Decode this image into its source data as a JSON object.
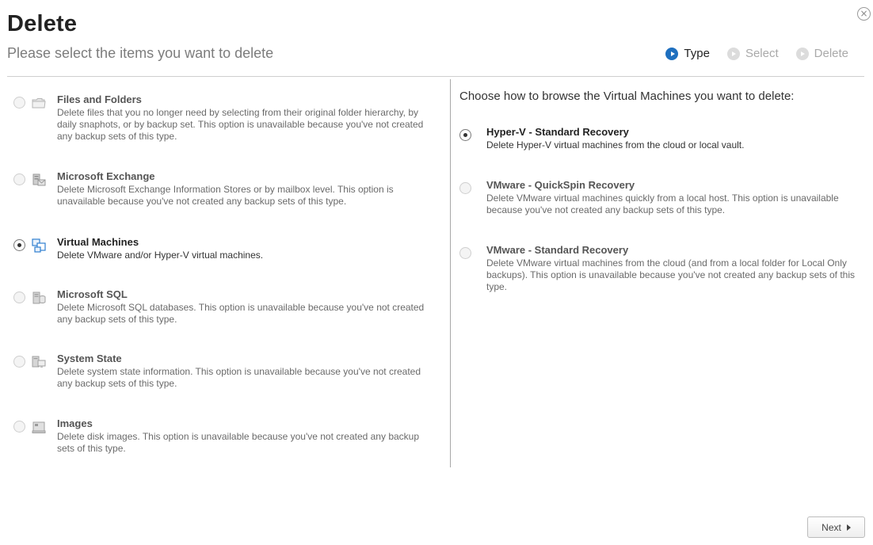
{
  "window": {
    "title": "Delete",
    "subtitle": "Please select the items you want to delete",
    "close_glyph": "×"
  },
  "steps": [
    {
      "label": "Type",
      "state": "active"
    },
    {
      "label": "Select",
      "state": "pending"
    },
    {
      "label": "Delete",
      "state": "pending"
    }
  ],
  "left_options": [
    {
      "title": "Files and Folders",
      "desc": "Delete files that you no longer need by selecting from their original folder hierarchy, by daily snaphots, or by backup set. This option is unavailable because you've not created any backup sets of this type.",
      "icon": "folder-icon",
      "selected": false,
      "enabled": false
    },
    {
      "title": "Microsoft Exchange",
      "desc": "Delete Microsoft Exchange Information Stores or by mailbox level. This option is unavailable because you've not created any backup sets of this type.",
      "icon": "exchange-server-icon",
      "selected": false,
      "enabled": false
    },
    {
      "title": "Virtual Machines",
      "desc": "Delete VMware and/or Hyper-V virtual machines.",
      "icon": "virtual-machines-icon",
      "selected": true,
      "enabled": true
    },
    {
      "title": "Microsoft SQL",
      "desc": "Delete Microsoft SQL databases. This option is unavailable because you've not created any backup sets of this type.",
      "icon": "sql-server-icon",
      "selected": false,
      "enabled": false
    },
    {
      "title": "System State",
      "desc": "Delete system state information. This option is unavailable because you've not created any backup sets of this type.",
      "icon": "system-state-icon",
      "selected": false,
      "enabled": false
    },
    {
      "title": "Images",
      "desc": "Delete disk images. This option is unavailable because you've not created any backup sets of this type.",
      "icon": "disk-image-icon",
      "selected": false,
      "enabled": false
    }
  ],
  "right_panel": {
    "heading": "Choose how to browse the Virtual Machines you want to delete:",
    "options": [
      {
        "title": "Hyper-V - Standard Recovery",
        "desc": "Delete Hyper-V virtual machines from the cloud or local vault.",
        "selected": true,
        "enabled": true
      },
      {
        "title": "VMware - QuickSpin Recovery",
        "desc": "Delete VMware virtual machines quickly from a local host. This option is unavailable because you've not created any backup sets of this type.",
        "selected": false,
        "enabled": false
      },
      {
        "title": "VMware - Standard Recovery",
        "desc": "Delete VMware virtual machines from the cloud (and from a local folder for Local Only backups). This option is unavailable because you've not created any backup sets of this type.",
        "selected": false,
        "enabled": false
      }
    ]
  },
  "footer": {
    "next_label": "Next"
  },
  "colors": {
    "accent": "#1e6fbf",
    "divider": "#cfcfcf"
  }
}
